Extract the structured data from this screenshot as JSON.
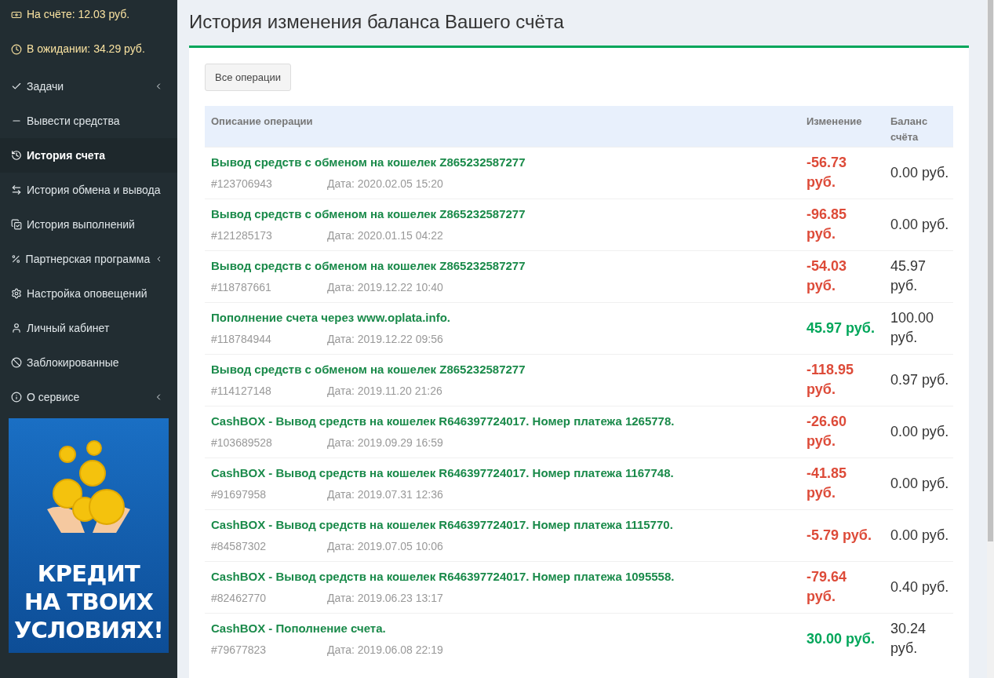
{
  "sidebar": {
    "balance": "На счёте: 12.03 руб.",
    "pending": "В ожидании: 34.29 руб.",
    "items": [
      {
        "label": "Задачи",
        "selected": false,
        "submenu": true
      },
      {
        "label": "Вывести средства",
        "selected": false,
        "submenu": false
      },
      {
        "label": "История счета",
        "selected": true,
        "submenu": false
      },
      {
        "label": "История обмена и вывода",
        "selected": false,
        "submenu": false
      },
      {
        "label": "История выполнений",
        "selected": false,
        "submenu": false
      },
      {
        "label": "Партнерская программа",
        "selected": false,
        "submenu": true
      },
      {
        "label": "Настройка оповещений",
        "selected": false,
        "submenu": false
      },
      {
        "label": "Личный кабинет",
        "selected": false,
        "submenu": false
      },
      {
        "label": "Заблокированные",
        "selected": false,
        "submenu": false
      },
      {
        "label": "О сервисе",
        "selected": false,
        "submenu": true
      }
    ],
    "banner": {
      "lines": [
        "КРЕДИТ",
        "НА ТВОИХ",
        "УСЛОВИЯХ!"
      ]
    }
  },
  "page_title": "История изменения баланса Вашего счёта",
  "filter_button": "Все операции",
  "table": {
    "columns": [
      "Описание операции",
      "Изменение",
      "Баланс счёта"
    ],
    "rows": [
      {
        "description": "Вывод средств с обменом на кошелек Z865232587277",
        "id": "#123706943",
        "date": "Дата: 2020.02.05 15:20",
        "change": "-56.73 руб.",
        "kind": "debit",
        "balance": "0.00 руб."
      },
      {
        "description": "Вывод средств с обменом на кошелек Z865232587277",
        "id": "#121285173",
        "date": "Дата: 2020.01.15 04:22",
        "change": "-96.85 руб.",
        "kind": "debit",
        "balance": "0.00 руб."
      },
      {
        "description": "Вывод средств с обменом на кошелек Z865232587277",
        "id": "#118787661",
        "date": "Дата: 2019.12.22 10:40",
        "change": "-54.03 руб.",
        "kind": "debit",
        "balance": "45.97 руб."
      },
      {
        "description": "Пополнение счета через www.oplata.info.",
        "id": "#118784944",
        "date": "Дата: 2019.12.22 09:56",
        "change": "45.97 руб.",
        "kind": "credit",
        "balance": "100.00 руб."
      },
      {
        "description": "Вывод средств с обменом на кошелек Z865232587277",
        "id": "#114127148",
        "date": "Дата: 2019.11.20 21:26",
        "change": "-118.95 руб.",
        "kind": "debit",
        "balance": "0.97 руб."
      },
      {
        "description": "CashBOX - Вывод средств на кошелек R646397724017. Номер платежа 1265778.",
        "id": "#103689528",
        "date": "Дата: 2019.09.29 16:59",
        "change": "-26.60 руб.",
        "kind": "debit",
        "balance": "0.00 руб."
      },
      {
        "description": "CashBOX - Вывод средств на кошелек R646397724017. Номер платежа 1167748.",
        "id": "#91697958",
        "date": "Дата: 2019.07.31 12:36",
        "change": "-41.85 руб.",
        "kind": "debit",
        "balance": "0.00 руб."
      },
      {
        "description": "CashBOX - Вывод средств на кошелек R646397724017. Номер платежа 1115770.",
        "id": "#84587302",
        "date": "Дата: 2019.07.05 10:06",
        "change": "-5.79 руб.",
        "kind": "debit",
        "balance": "0.00 руб."
      },
      {
        "description": "CashBOX - Вывод средств на кошелек R646397724017. Номер платежа 1095558.",
        "id": "#82462770",
        "date": "Дата: 2019.06.23 13:17",
        "change": "-79.64 руб.",
        "kind": "debit",
        "balance": "0.40 руб."
      },
      {
        "description": "CashBOX - Пополнение счета.",
        "id": "#79677823",
        "date": "Дата: 2019.06.08 22:19",
        "change": "30.00 руб.",
        "kind": "credit",
        "balance": "30.24 руб."
      }
    ]
  }
}
